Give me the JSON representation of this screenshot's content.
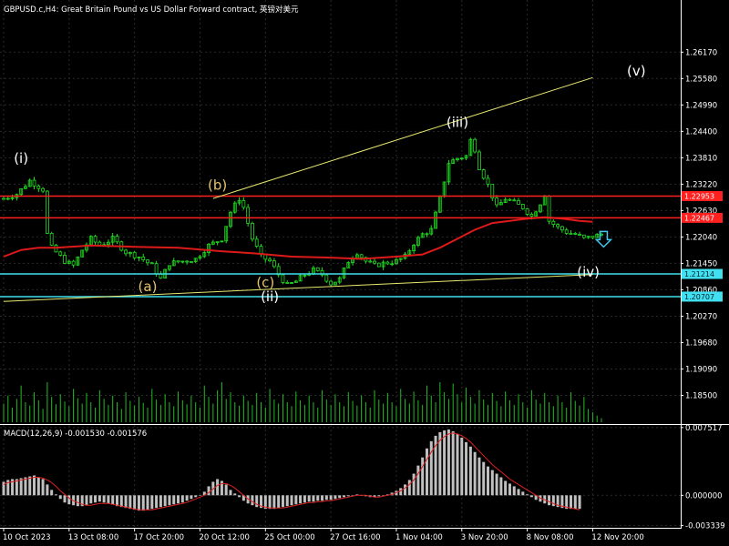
{
  "chart_data": {
    "type": "candlestick",
    "title": "GBPUSD.c,H4:  Great Britain Pound vs US Dollar Forward contract, 英镑对美元",
    "main_ylim": [
      1.179,
      1.2705
    ],
    "price_ticks": [
      "1.26170",
      "1.25580",
      "1.24990",
      "1.24400",
      "1.23810",
      "1.23220",
      "1.22630",
      "1.22040",
      "1.21450",
      "1.20860",
      "1.20270",
      "1.19680",
      "1.19090",
      "1.18500"
    ],
    "x_ticks": [
      {
        "label": "10 Oct 2023",
        "bar": 0
      },
      {
        "label": "13 Oct 08:00",
        "bar": 15
      },
      {
        "label": "17 Oct 20:00",
        "bar": 30
      },
      {
        "label": "20 Oct 12:00",
        "bar": 45
      },
      {
        "label": "25 Oct 00:00",
        "bar": 60
      },
      {
        "label": "27 Oct 16:00",
        "bar": 75
      },
      {
        "label": "1 Nov 04:00",
        "bar": 90
      },
      {
        "label": "3 Nov 20:00",
        "bar": 105
      },
      {
        "label": "8 Nov 08:00",
        "bar": 120
      },
      {
        "label": "12 Nov 20:00",
        "bar": 135
      }
    ],
    "price_path": [
      [
        0,
        1.229
      ],
      [
        3,
        1.23
      ],
      [
        6,
        1.233
      ],
      [
        9,
        1.231
      ],
      [
        10,
        1.221
      ],
      [
        11,
        1.218
      ],
      [
        14,
        1.215
      ],
      [
        16,
        1.214
      ],
      [
        18,
        1.2175
      ],
      [
        20,
        1.22
      ],
      [
        22,
        1.2185
      ],
      [
        25,
        1.22
      ],
      [
        28,
        1.217
      ],
      [
        31,
        1.216
      ],
      [
        34,
        1.214
      ],
      [
        36,
        1.211
      ],
      [
        38,
        1.2145
      ],
      [
        41,
        1.215
      ],
      [
        44,
        1.2155
      ],
      [
        47,
        1.2185
      ],
      [
        50,
        1.22
      ],
      [
        52,
        1.226
      ],
      [
        54,
        1.229
      ],
      [
        55,
        1.227
      ],
      [
        57,
        1.22
      ],
      [
        59,
        1.216
      ],
      [
        61,
        1.215
      ],
      [
        63,
        1.212
      ],
      [
        65,
        1.2095
      ],
      [
        67,
        1.2105
      ],
      [
        69,
        1.212
      ],
      [
        71,
        1.213
      ],
      [
        73,
        1.212
      ],
      [
        75,
        1.21
      ],
      [
        77,
        1.211
      ],
      [
        79,
        1.215
      ],
      [
        81,
        1.217
      ],
      [
        83,
        1.215
      ],
      [
        85,
        1.214
      ],
      [
        87,
        1.2145
      ],
      [
        90,
        1.215
      ],
      [
        92,
        1.216
      ],
      [
        94,
        1.219
      ],
      [
        96,
        1.221
      ],
      [
        98,
        1.222
      ],
      [
        100,
        1.229
      ],
      [
        102,
        1.237
      ],
      [
        104,
        1.238
      ],
      [
        106,
        1.2385
      ],
      [
        107,
        1.242
      ],
      [
        108,
        1.24
      ],
      [
        109,
        1.236
      ],
      [
        111,
        1.232
      ],
      [
        113,
        1.227
      ],
      [
        115,
        1.229
      ],
      [
        117,
        1.228
      ],
      [
        119,
        1.227
      ],
      [
        121,
        1.225
      ],
      [
        123,
        1.228
      ],
      [
        124,
        1.23
      ],
      [
        125,
        1.224
      ],
      [
        127,
        1.2225
      ],
      [
        129,
        1.2215
      ],
      [
        131,
        1.221
      ],
      [
        133,
        1.22
      ],
      [
        135,
        1.2205
      ],
      [
        137,
        1.221
      ]
    ],
    "bar_count": 138,
    "moving_average_path": [
      [
        0,
        1.216
      ],
      [
        4,
        1.2175
      ],
      [
        8,
        1.218
      ],
      [
        12,
        1.218
      ],
      [
        20,
        1.2185
      ],
      [
        30,
        1.2182
      ],
      [
        40,
        1.218
      ],
      [
        50,
        1.2172
      ],
      [
        58,
        1.2167
      ],
      [
        66,
        1.216
      ],
      [
        74,
        1.2158
      ],
      [
        82,
        1.2155
      ],
      [
        90,
        1.216
      ],
      [
        96,
        1.2165
      ],
      [
        100,
        1.218
      ],
      [
        104,
        1.22
      ],
      [
        108,
        1.222
      ],
      [
        112,
        1.2235
      ],
      [
        116,
        1.224
      ],
      [
        120,
        1.2245
      ],
      [
        124,
        1.2248
      ],
      [
        128,
        1.2245
      ],
      [
        132,
        1.224
      ],
      [
        135,
        1.2238
      ]
    ],
    "horizontal_lines": [
      {
        "price": 1.22953,
        "color": "#ff2020",
        "label": "1.22953"
      },
      {
        "price": 1.22467,
        "color": "#ff2020",
        "label": "1.22467"
      },
      {
        "price": 1.21214,
        "color": "#40e0f0",
        "label": "1.21214"
      },
      {
        "price": 1.20707,
        "color": "#40e0f0",
        "label": "1.20707"
      }
    ],
    "trend_lines": [
      {
        "from": [
          0,
          1.206
        ],
        "to": [
          135,
          1.212
        ],
        "color": "#e8e870"
      },
      {
        "from": [
          48,
          1.229
        ],
        "to": [
          135,
          1.256
        ],
        "color": "#e8e870"
      }
    ],
    "wave_labels": [
      {
        "text": "(i)",
        "bar": 4,
        "price": 1.237,
        "color": "#ffffff"
      },
      {
        "text": "(a)",
        "bar": 33,
        "price": 1.2083,
        "color": "#e8c36a"
      },
      {
        "text": "(b)",
        "bar": 49,
        "price": 1.231,
        "color": "#e8c36a"
      },
      {
        "text": "(c)",
        "bar": 60,
        "price": 1.2092,
        "color": "#e8c36a"
      },
      {
        "text": "(ii)",
        "bar": 61,
        "price": 1.206,
        "color": "#ffffff"
      },
      {
        "text": "(iii)",
        "bar": 104,
        "price": 1.245,
        "color": "#ffffff"
      },
      {
        "text": "(iv)",
        "bar": 134,
        "price": 1.2115,
        "color": "#ffffff"
      },
      {
        "text": "(v)",
        "bar": 145,
        "price": 1.2565,
        "color": "#ffffff"
      }
    ],
    "arrow": {
      "bar": 135,
      "price": 1.22,
      "direction": "down",
      "color": "#40c8f0"
    },
    "volume": [
      28,
      40,
      22,
      35,
      55,
      30,
      25,
      45,
      33,
      20,
      60,
      38,
      27,
      42,
      31,
      24,
      50,
      36,
      28,
      44,
      30,
      22,
      48,
      35,
      26,
      40,
      30,
      20,
      45,
      32,
      25,
      38,
      29,
      22,
      50,
      34,
      26,
      42,
      30,
      24,
      46,
      33,
      27,
      40,
      30,
      22,
      55,
      38,
      28,
      48,
      60,
      35,
      45,
      30,
      25,
      40,
      32,
      26,
      44,
      30,
      22,
      50,
      34,
      28,
      42,
      30,
      24,
      46,
      33,
      26,
      40,
      30,
      22,
      48,
      34,
      26,
      42,
      30,
      24,
      45,
      32,
      25,
      40,
      30,
      22,
      48,
      34,
      28,
      44,
      30,
      24,
      50,
      35,
      28,
      46,
      33,
      26,
      55,
      40,
      30,
      60,
      45,
      35,
      58,
      42,
      30,
      52,
      38,
      28,
      48,
      34,
      26,
      44,
      32,
      24,
      46,
      33,
      26,
      42,
      30,
      22,
      48,
      34,
      28,
      44,
      30,
      24,
      40,
      30,
      22,
      45,
      32,
      25,
      38,
      20,
      15,
      10,
      6
    ],
    "macd": {
      "label": "MACD(12,26,9) -0.001530 -0.001576",
      "ylim": [
        -0.0034,
        0.0077
      ],
      "ticks": [
        "0.007517",
        "0.000000",
        "-0.003339"
      ],
      "histogram": [
        0.0015,
        0.0017,
        0.0018,
        0.0018,
        0.0019,
        0.002,
        0.0021,
        0.0022,
        0.002,
        0.0018,
        0.0012,
        0.0006,
        0.0001,
        -0.0004,
        -0.0008,
        -0.001,
        -0.0011,
        -0.0012,
        -0.0012,
        -0.0011,
        -0.0009,
        -0.0008,
        -0.0007,
        -0.0008,
        -0.0009,
        -0.001,
        -0.0012,
        -0.0013,
        -0.0014,
        -0.0015,
        -0.0016,
        -0.0017,
        -0.0017,
        -0.0016,
        -0.0015,
        -0.0014,
        -0.0013,
        -0.0012,
        -0.0011,
        -0.001,
        -0.0009,
        -0.0008,
        -0.0006,
        -0.0004,
        -0.0002,
        0.0,
        0.0004,
        0.001,
        0.0015,
        0.0018,
        0.0016,
        0.0012,
        0.0006,
        0.0002,
        -0.0002,
        -0.0006,
        -0.0009,
        -0.0011,
        -0.0013,
        -0.0014,
        -0.0015,
        -0.0015,
        -0.0015,
        -0.0014,
        -0.0013,
        -0.0012,
        -0.0011,
        -0.001,
        -0.0009,
        -0.0008,
        -0.0007,
        -0.0007,
        -0.0006,
        -0.0006,
        -0.0005,
        -0.0005,
        -0.0004,
        -0.0003,
        -0.0002,
        -0.0001,
        0.0,
        0.0001,
        0.0,
        -0.0001,
        -0.0002,
        -0.0002,
        -0.0001,
        0.0,
        0.0001,
        0.0003,
        0.0005,
        0.0008,
        0.0012,
        0.0017,
        0.0024,
        0.0033,
        0.0042,
        0.0052,
        0.006,
        0.0066,
        0.007,
        0.0072,
        0.0073,
        0.0071,
        0.0068,
        0.0064,
        0.0059,
        0.0054,
        0.0048,
        0.0042,
        0.0037,
        0.0032,
        0.0028,
        0.0024,
        0.002,
        0.0016,
        0.0013,
        0.001,
        0.0007,
        0.0004,
        0.0001,
        -0.0002,
        -0.0005,
        -0.0007,
        -0.0009,
        -0.0011,
        -0.0012,
        -0.0013,
        -0.0014,
        -0.0015,
        -0.0015,
        -0.0015,
        -0.0015
      ],
      "signal": [
        0.0012,
        0.0014,
        0.0015,
        0.0016,
        0.0017,
        0.0018,
        0.0019,
        0.002,
        0.002,
        0.0019,
        0.0017,
        0.0014,
        0.001,
        0.0005,
        0.0001,
        -0.0003,
        -0.0006,
        -0.0008,
        -0.001,
        -0.0011,
        -0.0011,
        -0.001,
        -0.0009,
        -0.0009,
        -0.0009,
        -0.001,
        -0.0011,
        -0.0012,
        -0.0013,
        -0.0014,
        -0.0015,
        -0.0016,
        -0.0016,
        -0.0016,
        -0.0016,
        -0.0015,
        -0.0014,
        -0.0013,
        -0.0012,
        -0.0011,
        -0.001,
        -0.0009,
        -0.0008,
        -0.0006,
        -0.0004,
        -0.0002,
        0.0,
        0.0003,
        0.0007,
        0.0011,
        0.0013,
        0.0013,
        0.0011,
        0.0008,
        0.0004,
        0.0,
        -0.0004,
        -0.0007,
        -0.001,
        -0.0012,
        -0.0013,
        -0.0014,
        -0.0014,
        -0.0014,
        -0.0014,
        -0.0013,
        -0.0012,
        -0.0011,
        -0.001,
        -0.0009,
        -0.0008,
        -0.0008,
        -0.0007,
        -0.0007,
        -0.0006,
        -0.0006,
        -0.0005,
        -0.0004,
        -0.0003,
        -0.0002,
        -0.0001,
        0.0,
        0.0,
        0.0,
        -0.0001,
        -0.0002,
        -0.0002,
        -0.0001,
        0.0,
        0.0001,
        0.0003,
        0.0005,
        0.0008,
        0.0012,
        0.0017,
        0.0024,
        0.0032,
        0.004,
        0.0048,
        0.0055,
        0.0061,
        0.0065,
        0.0068,
        0.0069,
        0.0068,
        0.0066,
        0.0063,
        0.0059,
        0.0054,
        0.0049,
        0.0044,
        0.0039,
        0.0034,
        0.003,
        0.0026,
        0.0022,
        0.0018,
        0.0015,
        0.0012,
        0.0009,
        0.0006,
        0.0003,
        0.0,
        -0.0003,
        -0.0005,
        -0.0007,
        -0.0009,
        -0.0011,
        -0.0012,
        -0.0013,
        -0.0014,
        -0.0015,
        -0.0016
      ]
    },
    "colors": {
      "background": "#000000",
      "grid": "#2a2a2a",
      "candle": "#22dd22",
      "volume": "#22bb22",
      "moving_average": "#dd1a1a",
      "macd_hist": "#c0c0c0",
      "macd_signal": "#dd2020",
      "axis_text": "#ffffff"
    }
  }
}
